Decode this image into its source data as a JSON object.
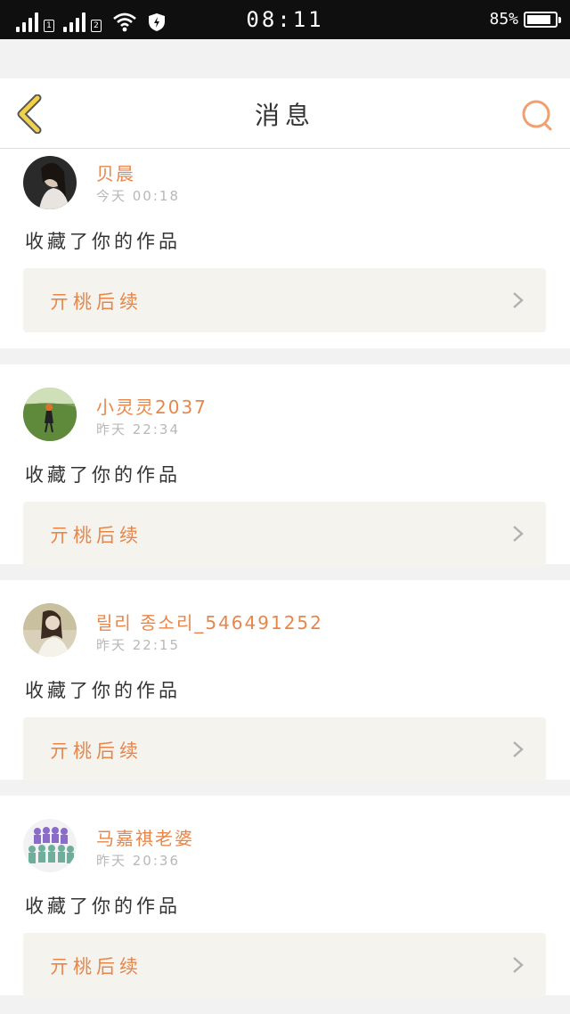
{
  "status_bar": {
    "time": "08:11",
    "battery_percent_label": "85%",
    "battery_level": 0.85,
    "sim1": "1",
    "sim2": "2",
    "icons": [
      "signal-icon",
      "signal-icon",
      "wifi-icon",
      "shield-icon",
      "battery-icon"
    ]
  },
  "header": {
    "title": "消息",
    "back_icon": "chevron-left-icon",
    "search_icon": "search-icon",
    "accent": "#f0d24a",
    "search_color": "#f0a070"
  },
  "colors": {
    "name": "#e8864a",
    "time": "#b8b8b8",
    "card_bg": "#ffffff",
    "work_bg": "#f4f3ee"
  },
  "messages": [
    {
      "username": "贝晨",
      "time": "今天 00:18",
      "action": "收藏了你的作品",
      "work_title": "亓桃后续"
    },
    {
      "username": "小灵灵2037",
      "time": "昨天 22:34",
      "action": "收藏了你的作品",
      "work_title": "亓桃后续"
    },
    {
      "username": "릴리 종소리_546491252",
      "time": "昨天 22:15",
      "action": "收藏了你的作品",
      "work_title": "亓桃后续"
    },
    {
      "username": "马嘉祺老婆",
      "time": "昨天 20:36",
      "action": "收藏了你的作品",
      "work_title": "亓桃后续"
    }
  ]
}
